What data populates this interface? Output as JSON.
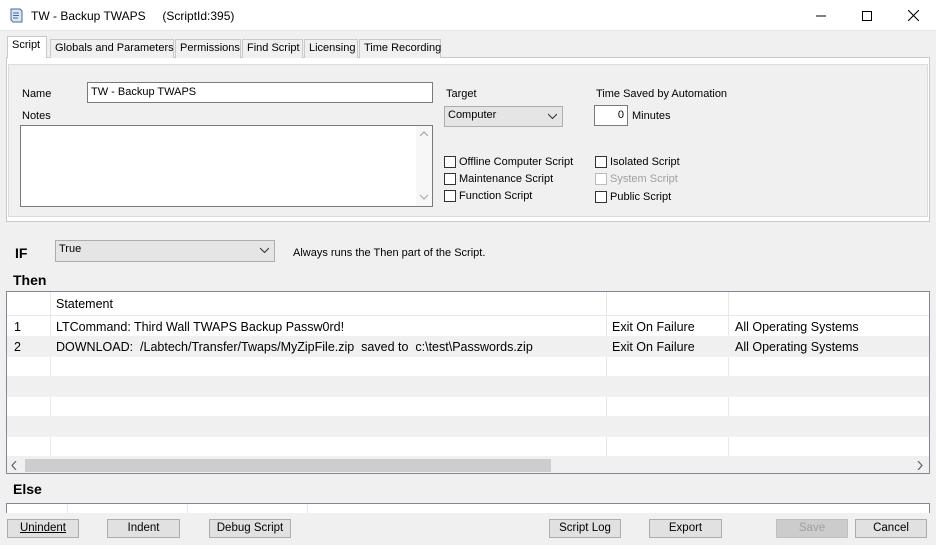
{
  "window": {
    "title": "TW - Backup TWAPS",
    "script_id": "(ScriptId:395)",
    "minimize_glyph": "—",
    "maximize_glyph": "☐",
    "close_glyph": "✕"
  },
  "tabs": [
    "Script",
    "Globals and Parameters",
    "Permissions",
    "Find Script",
    "Licensing",
    "Time Recording"
  ],
  "active_tab": "Script",
  "form": {
    "name_label": "Name",
    "name_value": "TW - Backup TWAPS",
    "notes_label": "Notes",
    "notes_value": "",
    "target_label": "Target",
    "target_value": "Computer",
    "time_saved_label": "Time Saved by Automation",
    "time_saved_value": "0",
    "minutes_label": "Minutes",
    "checkboxes": {
      "offline": {
        "label": "Offline Computer Script",
        "checked": false
      },
      "maintenance": {
        "label": "Maintenance Script",
        "checked": false
      },
      "function": {
        "label": "Function Script",
        "checked": false
      },
      "isolated": {
        "label": "Isolated Script",
        "checked": false
      },
      "system": {
        "label": "System Script",
        "checked": false,
        "disabled": true
      },
      "public": {
        "label": "Public Script",
        "checked": false
      }
    }
  },
  "if_section": {
    "label": "IF",
    "condition": "True",
    "description": "Always runs the Then part of the Script."
  },
  "then_label": "Then",
  "else_label": "Else",
  "grid": {
    "header": "Statement",
    "rows": [
      {
        "num": "1",
        "statement": "LTCommand: Third Wall TWAPS Backup Passw0rd!",
        "failure": "Exit On Failure",
        "os": "All Operating Systems"
      },
      {
        "num": "2",
        "statement": "DOWNLOAD:  /Labtech/Transfer/Twaps/MyZipFile.zip  saved to  c:\\test\\Passwords.zip",
        "failure": "Exit On Failure",
        "os": "All Operating Systems"
      }
    ]
  },
  "buttons": {
    "unindent": "Unindent",
    "indent": "Indent",
    "debug": "Debug Script",
    "script_log": "Script Log",
    "export": "Export",
    "save": "Save",
    "cancel": "Cancel"
  }
}
